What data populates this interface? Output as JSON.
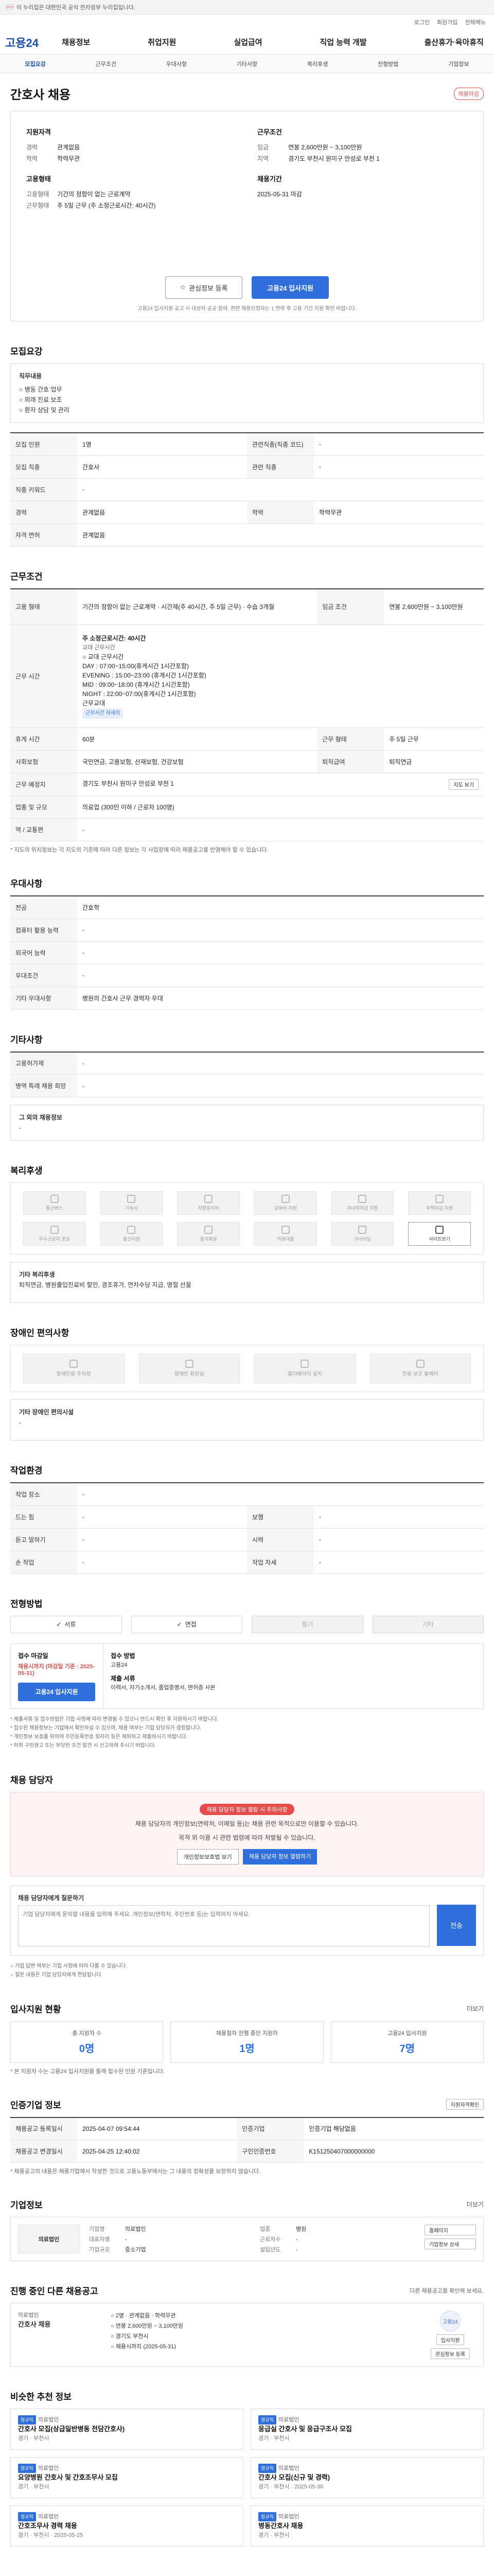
{
  "topbar": {
    "text": "이 누리집은 대한민국 공식 전자정부 누리집입니다."
  },
  "util": [
    "로그인",
    "회원가입",
    "전체메뉴"
  ],
  "gnb": {
    "logo": "고용24",
    "menu": [
      "채용정보",
      "취업지원",
      "실업급여",
      "직업 능력 개발",
      "출산휴가·육아휴직"
    ]
  },
  "subnav": {
    "items": [
      "모집요강",
      "근무조건",
      "우대사항",
      "기타사항",
      "복리후생",
      "전형방법",
      "기업정보"
    ],
    "active_index": 0
  },
  "header": {
    "title": "간호사 채용",
    "badge": "채용마감"
  },
  "summary": {
    "left_title": "지원자격",
    "left": [
      {
        "k": "경력",
        "v": "관계없음"
      },
      {
        "k": "학력",
        "v": "학력무관"
      }
    ],
    "left2_title": "고용형태",
    "left2": [
      {
        "k": "고용형태",
        "v": "기간의 정함이 없는 근로계약"
      },
      {
        "k": "근무형태",
        "v": "주 5일 근무 (주 소정근로시간: 40시간)"
      }
    ],
    "right_title": "근무조건",
    "right": [
      {
        "k": "임금",
        "v": "연봉 2,600만원 ~ 3,100만원"
      },
      {
        "k": "지역",
        "v": "경기도 부천시 원미구 안성로 부천 1"
      }
    ],
    "right2_title": "채용기간",
    "right2": [
      {
        "k": "",
        "v": "2025-05-31 마감"
      }
    ],
    "btn_scrap": "관심정보 등록",
    "btn_apply": "고용24 입사지원",
    "note": "고용24 입사지원 공고 시 대상자 공공 참여, 관련 채용신청자는 1 연락 후 고용 기간 지원 확인 바랍니다."
  },
  "sections": {
    "recruit": "모집요강",
    "work": "근무조건",
    "prefer": "우대사항",
    "etc": "기타사항",
    "welfare": "복리후생",
    "disabled": "장애인 편의사항",
    "env": "작업환경",
    "select": "전형방법",
    "contact": "채용 담당자",
    "stats": "입사지원 현황",
    "info": "인증기업 정보",
    "company": "기업정보",
    "other": "진행 중인 다른 채용공고",
    "similar": "비슷한 추천 정보"
  },
  "recruit": {
    "duty_label": "직무내용",
    "duty_lines": [
      "○ 병동 간호 업무",
      "○ 외래 진료 보조",
      "○ 환자 상담 및 관리"
    ],
    "rows": [
      {
        "k": "모집 인원",
        "v": "1명",
        "k2": "관련직종(직종 코드)",
        "v2": "-"
      },
      {
        "k": "모집 직종",
        "v": "간호사",
        "k2": "관련 직종",
        "v2": "-"
      },
      {
        "k": "직종 키워드",
        "v": "-",
        "k2": "",
        "v2": ""
      },
      {
        "k": "경력",
        "v": "관계없음",
        "k2": "학력",
        "v2": "학력무관"
      },
      {
        "k": "자격 면허",
        "v": "관계없음",
        "k2": "",
        "v2": ""
      }
    ]
  },
  "work": {
    "employ_label": "고용 형태",
    "employ_value": "기간의 정함이 없는 근로계약 · 시간제(주 40시간, 주 5일 근무) · 수습 3개월",
    "wage_label": "임금 조건",
    "wage_value": "연봉 2,600만원 ~ 3,100만원",
    "hours_label": "근무 시간",
    "hours_head": "주 소정근로시간: 40시간",
    "hours_lines": [
      "교대 근무시간",
      "○ 교대 근무시간",
      "DAY : 07:00~15:00(휴게시간 1시간포함)",
      "EVENING : 15:00~23:00 (휴게시간 1시간포함)",
      "MID : 09:00~18:00 (휴게시간 1시간포함)",
      "NIGHT : 22:00~07:00(휴게시간 1시간포함)",
      "근무교대"
    ],
    "hours_btn": "근무시간 자세히",
    "rows": [
      {
        "k": "휴게 시간",
        "v": "60분",
        "k2": "근무 형태",
        "v2": "주 5일 근무"
      },
      {
        "k": "사회보험",
        "v": "국민연금, 고용보험, 산재보험, 건강보험",
        "k2": "퇴직급여",
        "v2": "퇴직연금"
      },
      {
        "k": "근무 예정지",
        "v": "경기도 부천시 원미구 안성로 부천 1",
        "k2": "",
        "v2": ""
      },
      {
        "k": "업종 및 규모",
        "v": "의료업 (300인 이하 / 근로자 100명)",
        "k2": "",
        "v2": ""
      },
      {
        "k": "역 / 교통편",
        "v": "-",
        "k2": "",
        "v2": ""
      }
    ],
    "map_btn": "지도 보기",
    "note": "* 지도의 위치정보는 각 지도의 기준에 따라 다른 정보는 각 사업장에 따라 채용공고를 반영해야 할 수 있습니다."
  },
  "prefer": {
    "rows": [
      {
        "k": "전공",
        "v": "간호학"
      },
      {
        "k": "컴퓨터 활용 능력",
        "v": "-"
      },
      {
        "k": "외국어 능력",
        "v": "-"
      },
      {
        "k": "우대조건",
        "v": "-"
      },
      {
        "k": "기타 우대사항",
        "v": "병원의 간호사 근무 경력자 우대"
      }
    ]
  },
  "etc": {
    "rows": [
      {
        "k": "고용허가제",
        "v": "-"
      },
      {
        "k": "병역 특례 채용 희망",
        "v": "-"
      }
    ],
    "other_label": "그 외의 채용정보",
    "other_value": "-"
  },
  "welfare": {
    "items": [
      {
        "label": "통근버스",
        "on": false
      },
      {
        "label": "기숙사",
        "on": false
      },
      {
        "label": "차량유지비",
        "on": false
      },
      {
        "label": "교육비 지원",
        "on": false
      },
      {
        "label": "자녀학자금 지원",
        "on": false
      },
      {
        "label": "주택자금 지원",
        "on": false
      },
      {
        "label": "우수근로자 포상",
        "on": false
      },
      {
        "label": "출산지원",
        "on": false
      },
      {
        "label": "중식제공",
        "on": false
      },
      {
        "label": "직원대출",
        "on": false
      },
      {
        "label": "구내식당",
        "on": false
      },
      {
        "label": "사이트보기",
        "on": true
      }
    ],
    "etc_label": "기타 복리후생",
    "etc_value": "퇴직연금, 병원출입진료비 할인, 경조휴가, 연차수당 지급, 명절 선물"
  },
  "disabled": {
    "items": [
      "장애인용 주차장",
      "장애인 화장실",
      "엘리베이터 설치",
      "전동 보조 휠체어"
    ],
    "etc_label": "기타 장애인 편의시설",
    "etc_value": "-"
  },
  "env": {
    "rows": [
      {
        "k": "작업 장소",
        "v": "-",
        "k2": "",
        "v2": ""
      },
      {
        "k": "드는 힘",
        "v": "-",
        "k2": "보행",
        "v2": "-"
      },
      {
        "k": "듣고 말하기",
        "v": "-",
        "k2": "시력",
        "v2": "-"
      },
      {
        "k": "손 작업",
        "v": "-",
        "k2": "작업 자세",
        "v2": "-"
      }
    ]
  },
  "select": {
    "methods": [
      {
        "label": "서류",
        "on": true
      },
      {
        "label": "면접",
        "on": true
      },
      {
        "label": "필기",
        "on": false
      },
      {
        "label": "기타",
        "on": false
      }
    ],
    "apply_label": "접수 마감일",
    "apply_value": "채용시까지 (마감일 기준 : 2025-05-31)",
    "btn": "고용24 입사지원",
    "method_label": "접수 방법",
    "method_value": "고용24",
    "doc_label": "제출 서류",
    "doc_value": "이력서, 자기소개서, 졸업증명서, 면허증 사본",
    "notes": [
      "* 제출서류 및 접수방법은 기업 사정에 따라 변경될 수 있으니 반드시 확인 후 지원하시기 바랍니다.",
      "* 접수된 채용정보는 기업에서 확인하실 수 있으며, 채용 여부는 기업 담당자가 결정합니다.",
      "* 개인정보 보호를 위하여 주민등록번호 뒷자리 등은 제외하고 제출하시기 바랍니다.",
      "* 허위 구인광고 또는 부당한 조건 발견 시 신고하여 주시기 바랍니다."
    ]
  },
  "contact": {
    "badge": "채용 담당자 정보 열람 시 주의사항",
    "lines": [
      "채용 담당자의 개인정보(연락처, 이메일 등)는 채용 관련 목적으로만 이용할 수 있습니다.",
      "목적 외 이용 시 관련 법령에 따라 처벌될 수 있습니다."
    ],
    "btn1": "개인정보보호법 보기",
    "btn2": "채용 담당자 정보 열람하기"
  },
  "question": {
    "label": "채용 담당자에게 질문하기",
    "placeholder": "기업 담당자에게 문의할 내용을 입력해 주세요. 개인정보(연락처, 주민번호 등)는 입력하지 마세요.",
    "send": "전송",
    "notes": [
      "○ 기업 답변 여부는 기업 사정에 따라 다를 수 있습니다.",
      "○ 질문 내용은 기업 담당자에게 전달됩니다."
    ]
  },
  "stats": {
    "more": "더보기",
    "items": [
      {
        "label": "총 지원자 수",
        "value": "0명"
      },
      {
        "label": "채용절차 진행 중인 지원자",
        "value": "1명"
      },
      {
        "label": "고용24 입사지원",
        "value": "7명"
      }
    ],
    "note": "* 본 지원자 수는 고용24 입사지원을 통해 접수된 인원 기준입니다."
  },
  "info": {
    "btn": "지원자격확인",
    "rows": [
      {
        "k": "채용공고 등록일시",
        "v": "2025-04-07 09:54:44",
        "k2": "인증기업",
        "v2": "인증기업 해당없음"
      },
      {
        "k": "채용공고 변경일시",
        "v": "2025-04-25 12:40:02",
        "k2": "구인인증번호",
        "v2": "K151250407000000000"
      }
    ],
    "note": "* 채용공고의 내용은 채용기업에서 작성한 것으로 고용노동부에서는 그 내용의 정확성을 보장하지 않습니다."
  },
  "company": {
    "more": "더보기",
    "logo": "의료법인",
    "fields": [
      {
        "k": "기업명",
        "v": "의료법인"
      },
      {
        "k": "업종",
        "v": "병원"
      },
      {
        "k": "대표자명",
        "v": "-"
      },
      {
        "k": "근로자수",
        "v": "-"
      },
      {
        "k": "기업규모",
        "v": "중소기업"
      },
      {
        "k": "설립년도",
        "v": "-"
      }
    ],
    "btn1": "홈페이지",
    "btn2": "기업정보 상세"
  },
  "other": {
    "filter": "다른 채용공고를 확인해 보세요.",
    "company": "의료법인",
    "job": "간호사 채용",
    "lines": [
      "○ 2명 · 관계없음 · 학력무관",
      "○ 연봉 2,600만원 ~ 3,100만원",
      "○ 경기도 부천시",
      "○ 채용시까지 (2025-05-31)"
    ],
    "badge": "고용24",
    "btn1": "입사지원",
    "btn2": "관심정보 등록"
  },
  "similar": {
    "items": [
      {
        "tag": "정규직",
        "title": "간호사 모집(상급일반병동 전담간호사)",
        "company": "의료법인",
        "meta": "경기 · 부천시"
      },
      {
        "tag": "정규직",
        "title": "응급실 간호사 및 응급구조사 모집",
        "company": "의료법인",
        "meta": "경기 · 부천시"
      },
      {
        "tag": "정규직",
        "title": "요양병원 간호사 및 간호조무사 모집",
        "company": "의료법인",
        "meta": "경기 · 부천시"
      },
      {
        "tag": "정규직",
        "title": "간호사 모집(신규 및 경력)",
        "company": "의료법인",
        "meta": "경기 · 부천시 · 2025-05-30"
      },
      {
        "tag": "정규직",
        "title": "간호조무사 경력 채용",
        "company": "의료법인",
        "meta": "경기 · 부천시 · 2025-05-25"
      },
      {
        "tag": "정규직",
        "title": "병동간호사 채용",
        "company": "의료법인",
        "meta": "경기 · 부천시"
      }
    ]
  }
}
